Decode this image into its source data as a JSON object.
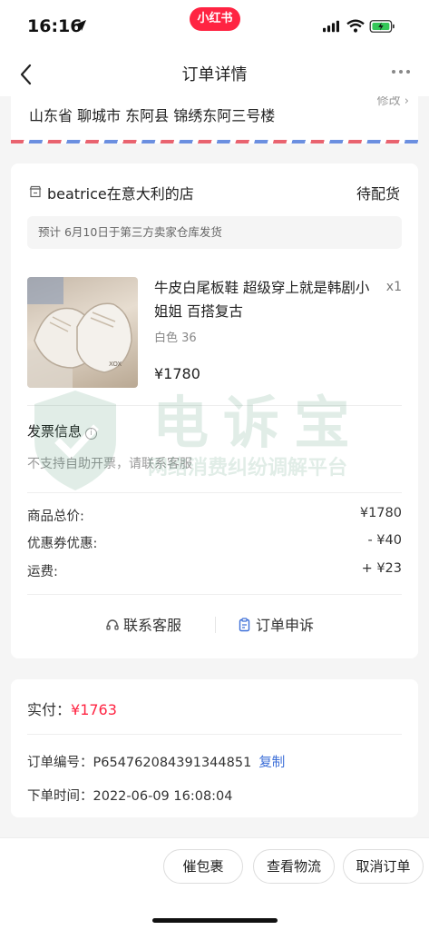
{
  "status_bar": {
    "time": "16:16",
    "app_badge": "小红书"
  },
  "nav": {
    "title": "订单详情"
  },
  "address": {
    "text": "山东省 聊城市 东阿县 锦绣东阿三号楼",
    "modify_label": "修改"
  },
  "order": {
    "shop_name": "beatrice在意大利的店",
    "status": "待配货",
    "shipping_note": "预计 6月10日于第三方卖家仓库发货",
    "product": {
      "title": "牛皮白尾板鞋 超级穿上就是韩剧小姐姐 百搭复古",
      "quantity": "x1",
      "spec": "白色 36",
      "price": "¥1780"
    },
    "invoice": {
      "title": "发票信息",
      "info_icon": "i",
      "note": "不支持自助开票，请联系客服"
    },
    "prices": [
      {
        "label": "商品总价:",
        "value": "¥1780"
      },
      {
        "label": "优惠券优惠:",
        "value": "- ¥40"
      },
      {
        "label": "运费:",
        "value": "+ ¥23"
      }
    ],
    "actions": {
      "contact_label": "联系客服",
      "complaint_label": "订单申诉"
    }
  },
  "payment": {
    "paid_label": "实付：",
    "paid_amount": "¥1763",
    "order_no_label": "订单编号：",
    "order_no": "P654762084391344851",
    "copy_label": "复制",
    "order_time_label": "下单时间：",
    "order_time": "2022-06-09 16:08:04"
  },
  "bottom_actions": {
    "urge_label": "催包裹",
    "logistics_label": "查看物流",
    "cancel_label": "取消订单"
  },
  "watermark": {
    "title": "电诉宝",
    "subtitle": "网络消费纠纷调解平台"
  },
  "colors": {
    "brand": "#ff2442",
    "link": "#3d6fd8",
    "watermark": "#1f7a4f"
  }
}
